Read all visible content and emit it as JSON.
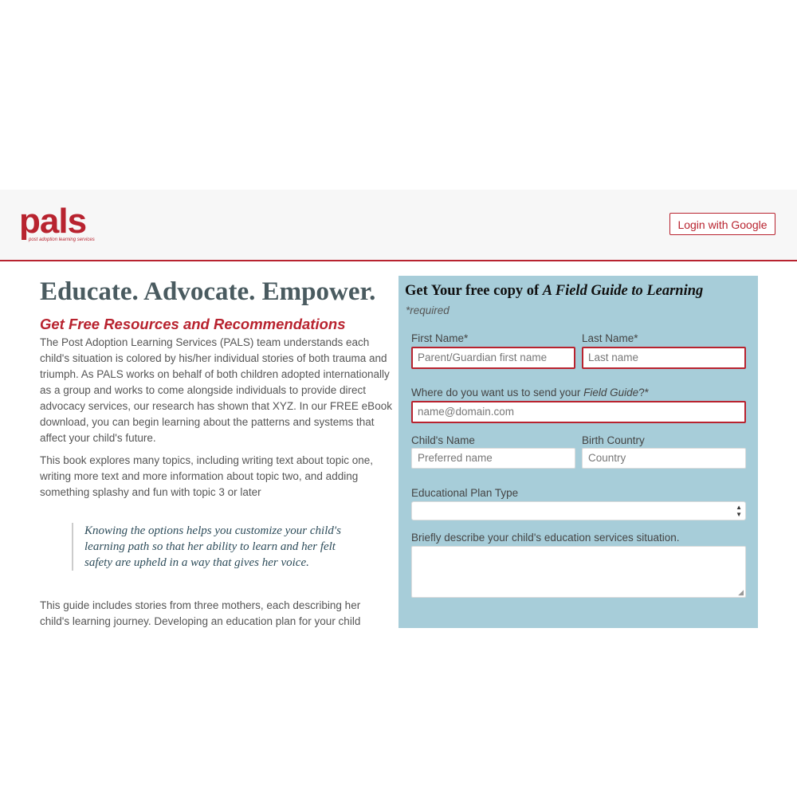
{
  "header": {
    "logo_text": "pals",
    "logo_subtext": "post adoption learning services",
    "login_label": "Login with Google"
  },
  "content": {
    "tagline": "Educate. Advocate. Empower.",
    "resources_heading": "Get Free Resources and Recommendations",
    "paragraph1": "The Post Adoption Learning Services (PALS) team understands each child's situation is colored by his/her individual stories of both trauma and triumph. As PALS works on behalf of both children adopted internationally as a group and works to come alongside individuals to provide direct advocacy services, our research has shown that XYZ. In our FREE eBook download, you can begin learning about the patterns and systems that affect your child's future.",
    "paragraph2": "This book explores many topics, including writing text about topic one, writing more text and more information about topic two, and adding something splashy and fun with topic 3 or later",
    "quote": "Knowing the options helps you customize your child's learning path so that her ability to learn and her felt safety are upheld in a way that gives her voice.",
    "paragraph3": "This guide includes stories from three mothers, each describing her child's learning journey. Developing an education plan for your child"
  },
  "form": {
    "title_prefix": "Get Your free copy of",
    "title_book": "A Field Guide to Learning",
    "required_note": "*required",
    "first_name_label": "First Name*",
    "first_name_placeholder": "Parent/Guardian first name",
    "last_name_label": "Last Name*",
    "last_name_placeholder": "Last name",
    "email_label_prefix": "Where do you want us to send your",
    "email_label_em": "Field Guide",
    "email_label_suffix": "?*",
    "email_placeholder": "name@domain.com",
    "child_name_label": "Child's Name",
    "child_name_placeholder": "Preferred name",
    "birth_country_label": "Birth Country",
    "birth_country_placeholder": "Country",
    "plan_type_label": "Educational Plan Type",
    "plan_type_value": "",
    "describe_label": "Briefly describe your child's education services situation.",
    "describe_value": ""
  },
  "colors": {
    "brand_red": "#b8232f",
    "form_bg": "#a7cdd9",
    "header_bg": "#f7f7f7"
  }
}
